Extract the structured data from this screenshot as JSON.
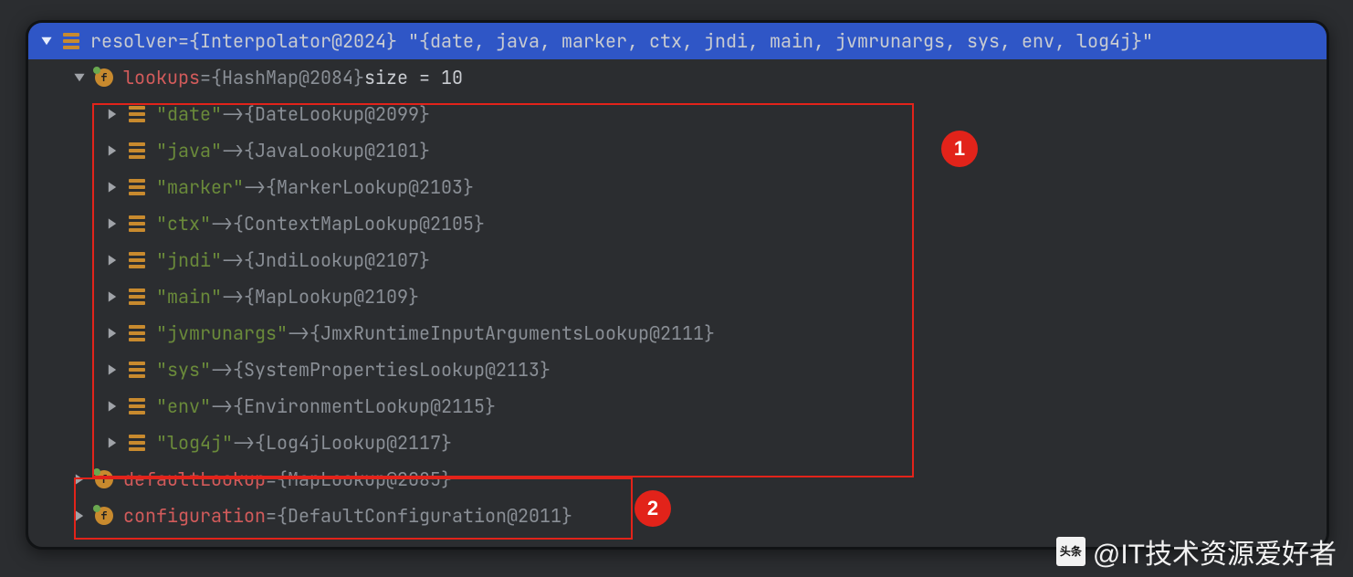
{
  "root": {
    "name": "resolver",
    "eq": " = ",
    "type": "{Interpolator@2024}",
    "value": "\"{date, java, marker, ctx, jndi, main, jvmrunargs, sys, env, log4j}\""
  },
  "lookups": {
    "name": "lookups",
    "eq": " = ",
    "type": "{HashMap@2084}",
    "size_label": "  size = 10",
    "entries": [
      {
        "key": "\"date\"",
        "arrow": " -> ",
        "val": "{DateLookup@2099}"
      },
      {
        "key": "\"java\"",
        "arrow": " -> ",
        "val": "{JavaLookup@2101}"
      },
      {
        "key": "\"marker\"",
        "arrow": " -> ",
        "val": "{MarkerLookup@2103}"
      },
      {
        "key": "\"ctx\"",
        "arrow": " -> ",
        "val": "{ContextMapLookup@2105}"
      },
      {
        "key": "\"jndi\"",
        "arrow": " -> ",
        "val": "{JndiLookup@2107}"
      },
      {
        "key": "\"main\"",
        "arrow": " -> ",
        "val": "{MapLookup@2109}"
      },
      {
        "key": "\"jvmrunargs\"",
        "arrow": " -> ",
        "val": "{JmxRuntimeInputArgumentsLookup@2111}"
      },
      {
        "key": "\"sys\"",
        "arrow": " -> ",
        "val": "{SystemPropertiesLookup@2113}"
      },
      {
        "key": "\"env\"",
        "arrow": " -> ",
        "val": "{EnvironmentLookup@2115}"
      },
      {
        "key": "\"log4j\"",
        "arrow": " -> ",
        "val": "{Log4jLookup@2117}"
      }
    ]
  },
  "siblings": [
    {
      "name": "defaultLookup",
      "eq": " = ",
      "val": "{MapLookup@2085}"
    },
    {
      "name": "configuration",
      "eq": " = ",
      "val": "{DefaultConfiguration@2011}"
    }
  ],
  "annotations": {
    "badge1": "1",
    "badge2": "2"
  },
  "watermark": {
    "logo": "头条",
    "text": "@IT技术资源爱好者"
  }
}
